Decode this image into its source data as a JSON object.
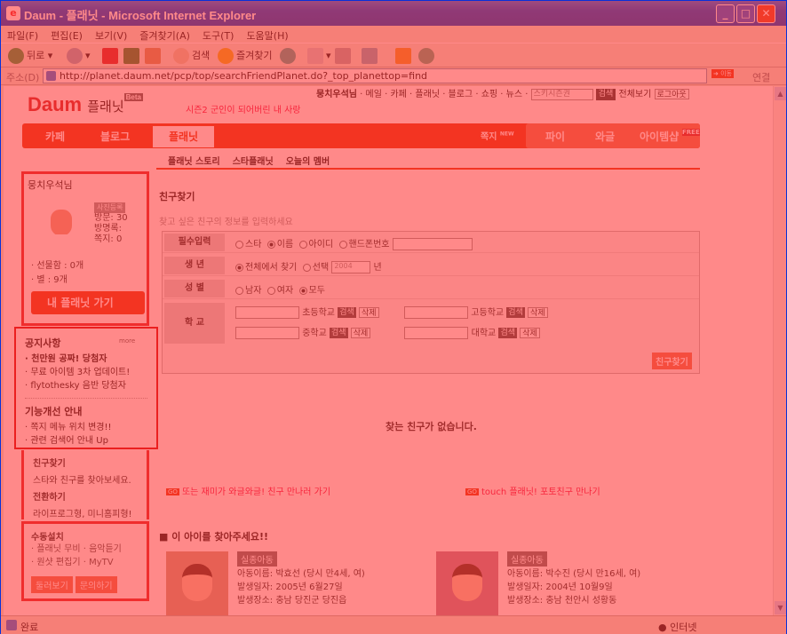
{
  "window": {
    "title": "Daum - 플래닛 - Microsoft Internet Explorer"
  },
  "menu": [
    "파일(F)",
    "편집(E)",
    "보기(V)",
    "즐겨찾기(A)",
    "도구(T)",
    "도움말(H)"
  ],
  "toolbar": {
    "back": "뒤로",
    "search": "검색",
    "favorites": "즐겨찾기"
  },
  "address": {
    "label": "주소(D)",
    "url": "http://planet.daum.net/pcp/top/searchFriendPlanet.do?_top_planettop=find",
    "go": "이동",
    "links": "연결"
  },
  "status": {
    "left": "완료",
    "right": "인터넷"
  },
  "site": {
    "topnav": {
      "user": "뭉치우석님",
      "links": "메일 · 카페 · 플래닛 · 블로그 · 쇼핑 · 뉴스",
      "search_placeholder": "스키시즌권",
      "search_btn": "검색",
      "all": "전체보기",
      "logout": "로그아웃"
    },
    "logo": {
      "brand": "Daum",
      "name": "플래닛",
      "beta": "Beta"
    },
    "promo": "시즌2 군인이 되어버린 내 사랑",
    "mainnav": {
      "cafe": "카페",
      "blog": "블로그",
      "planet": "플래닛",
      "note": "쪽지",
      "note_new": "NEW",
      "pie": "파이",
      "wagle": "와글",
      "itemshop": "아이템샵",
      "free": "FREE"
    },
    "subnav": [
      "플래닛 스토리",
      "스타플래닛",
      "오늘의 멤버"
    ],
    "profile": {
      "name": "뭉치우석님",
      "photo_badge": "사진등록",
      "visits": "방문: 30",
      "guestbook": "방명록:",
      "notes": "쪽지: 0",
      "gifts": "· 선물함 : 0개",
      "stars": "· 별 :   9개",
      "myplanet": "내 플래닛",
      "go": "가기"
    },
    "notice": {
      "title": "공지사항",
      "more": "more",
      "items": [
        "· 천만원 공짜! 당첨자",
        "· 무료 아이템 3차 업데이트!",
        "· flytothesky 음반 당첨자"
      ],
      "title2": "기능개선 안내",
      "items2": [
        "· 쪽지 메뉴 위치 변경!!",
        "· 관련 검색어 안내 Up"
      ]
    },
    "find_side": {
      "title": "친구찾기",
      "desc": "스타와 친구를 찾아보세요.",
      "switch": "전환하기",
      "switch_desc": "라이프로그형, 미니홈피형!"
    },
    "manual": {
      "title": "수동설치",
      "items": "· 플래닛 무비  · 음악듣기",
      "items2": "· 원샷 편집기  · MyTV",
      "btn1": "둘러보기",
      "btn2": "문의하기"
    },
    "find": {
      "title": "친구찾기",
      "sub": "찾고 싶은 친구의 정보를 입력하세요",
      "row1_label": "필수입력",
      "r_star": "스타",
      "r_name": "이름",
      "r_id": "아이디",
      "r_phone": "핸드폰번호",
      "row2_label": "생 년",
      "r_all": "전체에서 찾기",
      "r_select": "선택",
      "year": "2004",
      "year_unit": "년",
      "row3_label": "성 별",
      "r_m": "남자",
      "r_f": "여자",
      "r_all2": "모두",
      "row4_label": "학 교",
      "elem": "초등학교",
      "high": "고등학교",
      "mid": "중학교",
      "univ": "대학교",
      "sbtn": "검색",
      "dbtn": "삭제",
      "findbtn": "친구찾기"
    },
    "none": "찾는 친구가 없습니다.",
    "link1": "또는 재미가 와글와글! 친구 만나러 가기",
    "link2": "touch 플래닛! 포토친구 만나기",
    "go_tag": "GO",
    "missing": {
      "title": "이 아이를 찾아주세요!!",
      "c1": {
        "tag": "실종아동",
        "name": "아동이름: 박효선 (당시 만4세, 여)",
        "date": "발생일자: 2005년 6월27일",
        "place": "발생장소: 충남 당진군 당진읍"
      },
      "c2": {
        "tag": "실종아동",
        "name": "아동이름: 박수진 (당시 만16세, 여)",
        "date": "발생일자: 2004년 10월9일",
        "place": "발생장소: 충남 천안시 성황동"
      }
    }
  }
}
